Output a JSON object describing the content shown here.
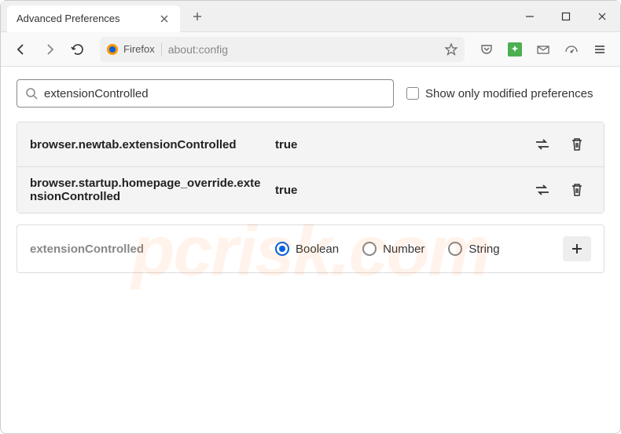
{
  "window": {
    "tab_title": "Advanced Preferences"
  },
  "toolbar": {
    "identity_label": "Firefox",
    "url": "about:config"
  },
  "search": {
    "value": "extensionControlled",
    "checkbox_label": "Show only modified preferences"
  },
  "results": [
    {
      "name": "browser.newtab.extensionControlled",
      "value": "true"
    },
    {
      "name": "browser.startup.homepage_override.extensionControlled",
      "value": "true"
    }
  ],
  "add": {
    "name": "extensionControlled",
    "types": [
      "Boolean",
      "Number",
      "String"
    ],
    "selected": "Boolean"
  },
  "watermark": "pcrisk.com"
}
